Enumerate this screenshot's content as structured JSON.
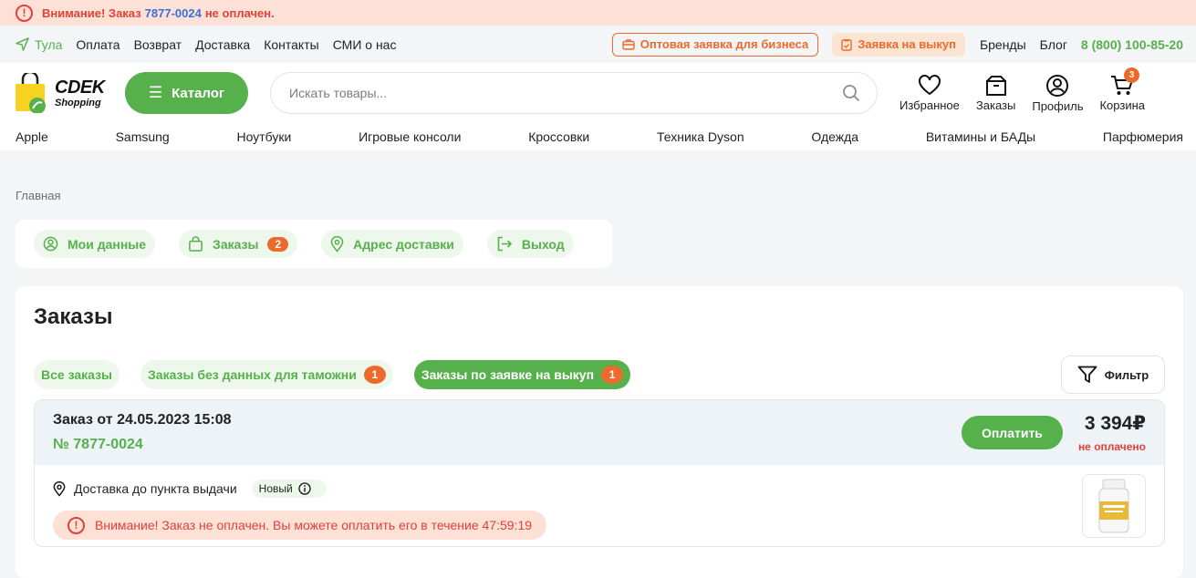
{
  "alert": {
    "prefix": "Внимание! Заказ",
    "order": "7877-0024",
    "suffix": "не оплачен."
  },
  "topnav": {
    "city": "Тула",
    "links": [
      "Оплата",
      "Возврат",
      "Доставка",
      "Контакты",
      "СМИ о нас"
    ],
    "wholesale": "Оптовая заявка для бизнеса",
    "buyout": "Заявка на выкуп",
    "brands": "Бренды",
    "blog": "Блог",
    "phone": "8 (800) 100-85-20"
  },
  "header": {
    "logo_line1": "CDEK",
    "logo_line2": "Shopping",
    "catalog": "Каталог",
    "search_placeholder": "Искать товары...",
    "favorites": "Избранное",
    "orders": "Заказы",
    "profile": "Профиль",
    "cart": "Корзина",
    "cart_count": "3"
  },
  "categories": [
    "Apple",
    "Samsung",
    "Ноутбуки",
    "Игровые консоли",
    "Кроссовки",
    "Техника Dyson",
    "Одежда",
    "Витамины и БАДы",
    "Парфюмерия"
  ],
  "breadcrumb": "Главная",
  "profile_tabs": {
    "my_data": "Мои данные",
    "orders": "Заказы",
    "orders_count": "2",
    "address": "Адрес доставки",
    "logout": "Выход"
  },
  "orders": {
    "title": "Заказы",
    "filters": {
      "all": "Все заказы",
      "no_customs": "Заказы без данных для таможни",
      "no_customs_count": "1",
      "buyout": "Заказы по заявке на выкуп",
      "buyout_count": "1"
    },
    "filter_btn": "Фильтр",
    "order": {
      "date": "Заказ от 24.05.2023 15:08",
      "number": "№ 7877-0024",
      "pay": "Оплатить",
      "price": "3 394₽",
      "payment_status": "не оплачено",
      "delivery": "Доставка до пункта выдачи",
      "status": "Новый",
      "warning": "Внимание! Заказ не оплачен. Вы можете оплатить его в течение 47:59:19"
    }
  },
  "colors": {
    "green": "#56b04c",
    "orange": "#ec6a2c",
    "red": "#e0413a",
    "alert_bg": "#fde0d6"
  }
}
